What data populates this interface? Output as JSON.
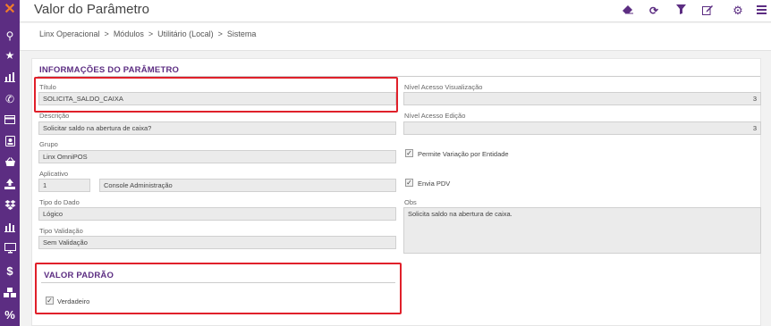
{
  "sidebar": {
    "logo": "✕",
    "icons": [
      "search-icon",
      "star-icon",
      "bar-chart-icon",
      "phone-icon",
      "card-icon",
      "contact-icon",
      "basket-icon",
      "upload-icon",
      "dropbox-icon",
      "stats-icon",
      "monitor-icon",
      "dollar-icon",
      "cubes-icon",
      "percent-icon"
    ]
  },
  "header": {
    "title": "Valor do Parâmetro",
    "icons": [
      "eraser-icon",
      "refresh-icon",
      "filter-icon",
      "edit-icon",
      "gear-icon",
      "menu-icon"
    ]
  },
  "breadcrumb": [
    "Linx Operacional",
    "Módulos",
    "Utilitário (Local)",
    "Sistema"
  ],
  "breadcrumb_sep": ">",
  "info": {
    "heading": "INFORMAÇÕES DO PARÂMETRO",
    "titulo_label": "Título",
    "titulo_value": "SOLICITA_SALDO_CAIXA",
    "descricao_label": "Descrição",
    "descricao_value": "Solicitar saldo na abertura de caixa?",
    "grupo_label": "Grupo",
    "grupo_value": "Linx OmniPOS",
    "aplicativo_label": "Aplicativo",
    "aplicativo_code": "1",
    "aplicativo_name": "Console Administração",
    "tipo_dado_label": "Tipo do Dado",
    "tipo_dado_value": "Lógico",
    "tipo_validacao_label": "Tipo Validação",
    "tipo_validacao_value": "Sem Validação",
    "nivel_visualizacao_label": "Nível Acesso Visualização",
    "nivel_visualizacao_value": "3",
    "nivel_edicao_label": "Nível Acesso Edição",
    "nivel_edicao_value": "3",
    "permite_variacao_label": "Permite Variação por Entidade",
    "permite_variacao_checked": true,
    "envia_pdv_label": "Envia PDV",
    "envia_pdv_checked": true,
    "obs_label": "Obs",
    "obs_value": "Solicita saldo na abertura de caixa."
  },
  "default_value": {
    "heading": "VALOR PADRÃO",
    "verdadeiro_label": "Verdadeiro",
    "verdadeiro_checked": true
  },
  "colors": {
    "sidebar": "#5c2d82",
    "accent": "#5c2d82",
    "logo": "#f07c2a",
    "highlight": "#e0202a"
  }
}
